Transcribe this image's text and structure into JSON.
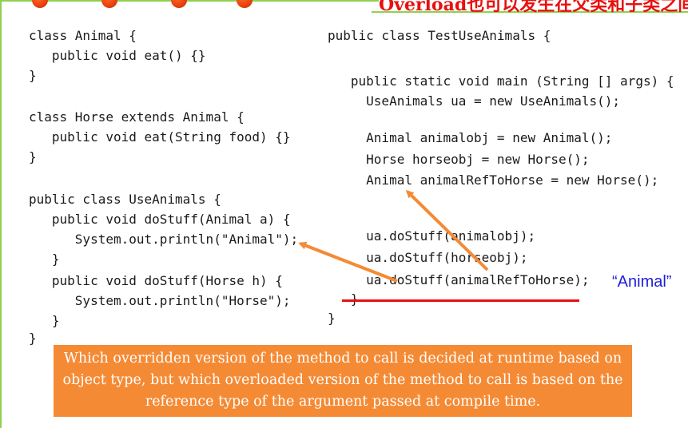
{
  "header": {
    "title": "Overload也可以发生在父类和子类之间",
    "accent_color": "#8fd14f",
    "dot_color": "#e8400c"
  },
  "code_left": {
    "lines": [
      "class Animal {",
      "   public void eat() {}",
      "}",
      "",
      "",
      "class Horse extends Animal {",
      "   public void eat(String food) {}",
      "}",
      "",
      "",
      "public class UseAnimals {",
      "   public void doStuff(Animal a) {",
      "      System.out.println(\"Animal\");",
      "   }",
      "   public void doStuff(Horse h) {",
      "      System.out.println(\"Horse\");",
      "   }",
      "}"
    ]
  },
  "code_right": {
    "lines": [
      "public class TestUseAnimals {",
      "",
      "   public static void main (String [] args) {",
      "     UseAnimals ua = new UseAnimals();",
      "",
      "     Animal animalobj = new Animal();",
      "     Horse horseobj = new Horse();",
      "     Animal animalRefToHorse = new Horse();",
      "",
      "",
      "     ua.doStuff(animalobj);",
      "     ua.doStuff(horseobj);",
      "     ua.doStuff(animalRefToHorse);",
      "   }",
      "}"
    ]
  },
  "output_label": "“Animal”",
  "note": "Which overridden version of the method to call is decided at runtime based on object type, but which overloaded version of the method to call is based on the reference type of the argument passed at compile time.",
  "colors": {
    "arrow": "#f58a34",
    "underline": "#e81010",
    "output_text": "#1f1fd6",
    "note_bg": "#f58a34"
  }
}
